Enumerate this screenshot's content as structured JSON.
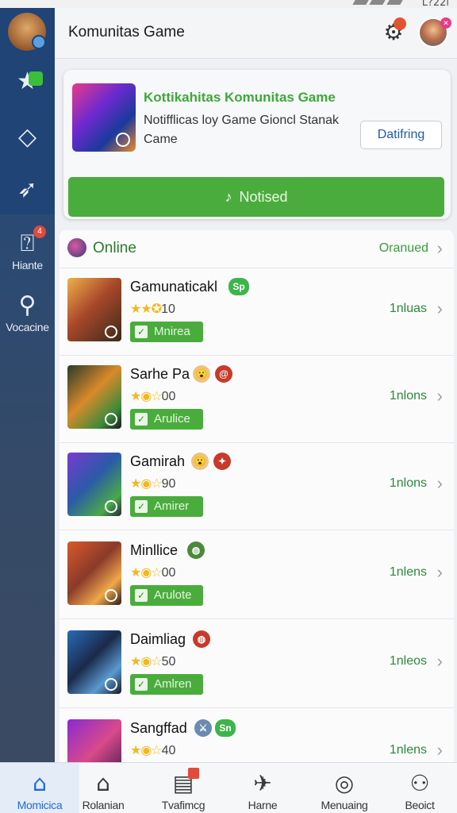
{
  "status_bar": {
    "time": "L?22l"
  },
  "sidebar": {
    "items": [
      {
        "name": "star-flag",
        "label": ""
      },
      {
        "name": "diamond",
        "label": ""
      },
      {
        "name": "rocket",
        "label": ""
      },
      {
        "name": "hiante",
        "label": "Hiante",
        "badge": "4"
      },
      {
        "name": "search",
        "label": "Vocacine"
      }
    ]
  },
  "header": {
    "title": "Komunitas Game"
  },
  "notification": {
    "title": "Kottikahitas Komunitas Game",
    "body": "Notifflicas loy Game Gioncl Stanak Came",
    "detail_button": "Datifring",
    "action_button": "Notised"
  },
  "online": {
    "label": "Online",
    "action": "Oranued"
  },
  "games": [
    {
      "name": "Gamunaticakl",
      "badge": "Sp",
      "badge_type": "green",
      "rating_text": "10",
      "stars": "★★✪",
      "status": "Mnirea",
      "count": "1nluas"
    },
    {
      "name": "Sarhe Pa",
      "badge": "😮",
      "badge_type": "emoji",
      "badge2": "@",
      "rating_text": "00",
      "stars": "★◉☆",
      "status": "Arulice",
      "count": "1nlons"
    },
    {
      "name": "Gamirah",
      "badge": "😮",
      "badge_type": "emoji",
      "badge2": "✦",
      "rating_text": "90",
      "stars": "★◉☆",
      "status": "Amirer",
      "count": "1nlons"
    },
    {
      "name": "Minllice",
      "badge": "◍",
      "badge_type": "red",
      "rating_text": "00",
      "stars": "★◉☆",
      "status": "Arulote",
      "count": "1nlens"
    },
    {
      "name": "Daimliag",
      "badge": "◍",
      "badge_type": "red",
      "rating_text": "50",
      "stars": "★◉☆",
      "status": "Amlren",
      "count": "1nleos"
    },
    {
      "name": "Sangffad",
      "badge": "Sn",
      "badge_type": "green",
      "rating_text": "40",
      "stars": "★◉☆",
      "status": "",
      "count": "1nlens"
    }
  ],
  "bottom_nav": [
    {
      "label": "Momicica",
      "icon": "home-icon",
      "active": true
    },
    {
      "label": "Rolanian",
      "icon": "house-icon",
      "active": false
    },
    {
      "label": "Tvafimcg",
      "icon": "calendar-icon",
      "active": false
    },
    {
      "label": "Harne",
      "icon": "plane-icon",
      "active": false
    },
    {
      "label": "Menuaing",
      "icon": "compass-icon",
      "active": false
    },
    {
      "label": "Beoict",
      "icon": "user-icon",
      "active": false
    }
  ],
  "colors": {
    "accent_green": "#4aac3c",
    "sidebar_blue": "#1f4475",
    "active_blue": "#1f6ad0"
  }
}
